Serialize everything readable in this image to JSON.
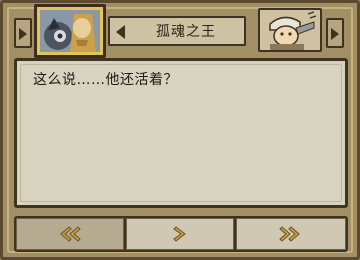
{
  "header": {
    "speaker_name": "孤魂之王",
    "left_portrait_icon": "ghost-king-portrait",
    "right_portrait_icon": "soldier-portrait"
  },
  "dialog": {
    "text": "这么说……他还活着？"
  },
  "controls": {
    "back_icon": "double-chevron-left-icon",
    "next_icon": "chevron-right-icon",
    "skip_icon": "double-chevron-right-icon"
  },
  "colors": {
    "frame": "#a38f66",
    "panel": "#d8d2c0",
    "highlight": "#e5c35a",
    "dark": "#3e3322"
  }
}
